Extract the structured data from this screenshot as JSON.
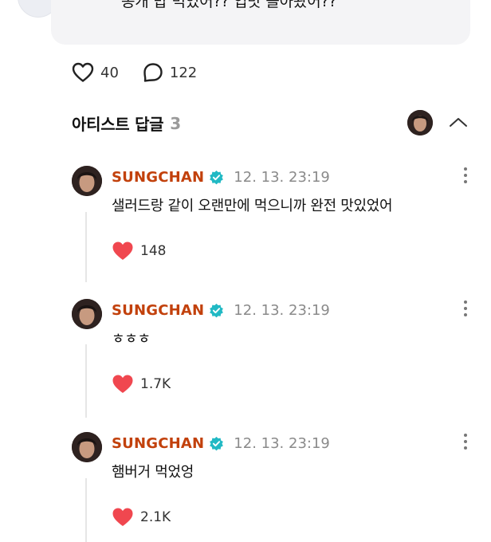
{
  "post": {
    "text": "똥개 밥 먹었어?? 입맛 돌아왔어??"
  },
  "reactions": {
    "like_count": "40",
    "comment_count": "122",
    "like_icon": "heart-outline-icon",
    "comment_icon": "speech-bubble-icon"
  },
  "artist_replies": {
    "title": "아티스트 답글",
    "count": "3"
  },
  "colors": {
    "artist_name": "#c2410c",
    "verified": "#21b9c4",
    "like_filled": "#f0474f"
  },
  "comments": [
    {
      "author": "SUNGCHAN",
      "time": "12. 13. 23:19",
      "text": "샐러드랑 같이 오랜만에 먹으니까 완전 맛있었어",
      "likes": "148"
    },
    {
      "author": "SUNGCHAN",
      "time": "12. 13. 23:19",
      "text": "ㅎㅎㅎ",
      "likes": "1.7K"
    },
    {
      "author": "SUNGCHAN",
      "time": "12. 13. 23:19",
      "text": "햄버거 먹었엉",
      "likes": "2.1K"
    }
  ]
}
